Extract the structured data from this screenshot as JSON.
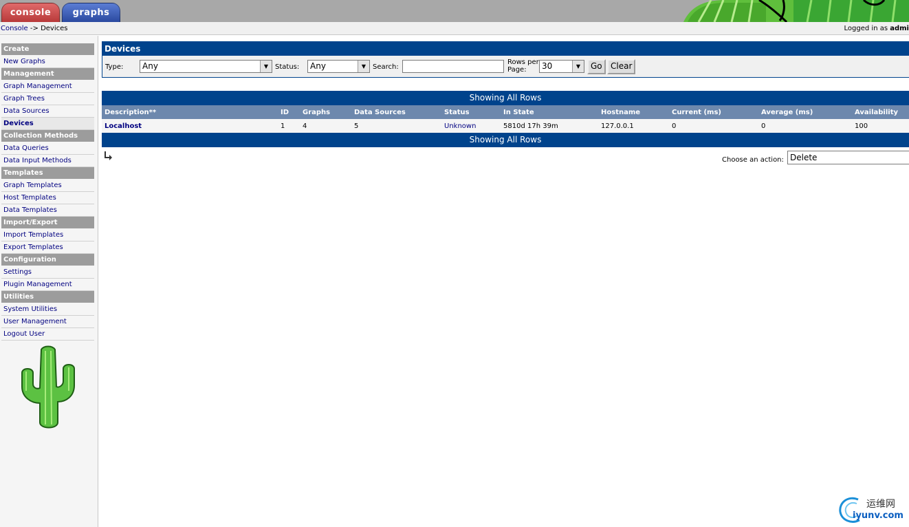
{
  "tabs": {
    "console": "console",
    "graphs": "graphs"
  },
  "breadcrumb": {
    "root": "Console",
    "separator": " -> ",
    "current": "Devices"
  },
  "login": {
    "prefix": "Logged in as ",
    "user": "admi"
  },
  "sidebar": [
    {
      "type": "header",
      "label": "Create"
    },
    {
      "type": "item",
      "label": "New Graphs"
    },
    {
      "type": "header",
      "label": "Management"
    },
    {
      "type": "item",
      "label": "Graph Management"
    },
    {
      "type": "item",
      "label": "Graph Trees"
    },
    {
      "type": "item",
      "label": "Data Sources"
    },
    {
      "type": "item",
      "label": "Devices",
      "active": true
    },
    {
      "type": "header",
      "label": "Collection Methods"
    },
    {
      "type": "item",
      "label": "Data Queries"
    },
    {
      "type": "item",
      "label": "Data Input Methods"
    },
    {
      "type": "header",
      "label": "Templates"
    },
    {
      "type": "item",
      "label": "Graph Templates"
    },
    {
      "type": "item",
      "label": "Host Templates"
    },
    {
      "type": "item",
      "label": "Data Templates"
    },
    {
      "type": "header",
      "label": "Import/Export"
    },
    {
      "type": "item",
      "label": "Import Templates"
    },
    {
      "type": "item",
      "label": "Export Templates"
    },
    {
      "type": "header",
      "label": "Configuration"
    },
    {
      "type": "item",
      "label": "Settings"
    },
    {
      "type": "item",
      "label": "Plugin Management"
    },
    {
      "type": "header",
      "label": "Utilities"
    },
    {
      "type": "item",
      "label": "System Utilities"
    },
    {
      "type": "item",
      "label": "User Management"
    },
    {
      "type": "item",
      "label": "Logout User"
    }
  ],
  "filter": {
    "title": "Devices",
    "type_label": "Type:",
    "type_value": "Any",
    "status_label": "Status:",
    "status_value": "Any",
    "search_label": "Search:",
    "search_value": "",
    "rows_label_1": "Rows per",
    "rows_label_2": "Page:",
    "rows_value": "30",
    "go_label": "Go",
    "clear_label": "Clear"
  },
  "results": {
    "showing_text": "Showing All Rows",
    "columns": [
      "Description**",
      "ID",
      "Graphs",
      "Data Sources",
      "Status",
      "In State",
      "Hostname",
      "Current (ms)",
      "Average (ms)",
      "Availability"
    ],
    "rows": [
      [
        "Localhost",
        "1",
        "4",
        "5",
        "Unknown",
        "5810d 17h 39m",
        "127.0.0.1",
        "0",
        "0",
        "100"
      ]
    ]
  },
  "action": {
    "label": "Choose an action:",
    "value": "Delete"
  },
  "watermark": {
    "line1": "运维网",
    "line2": "iyunv.com"
  },
  "colors": {
    "header_blue": "#00438c",
    "column_header": "#6d88ad",
    "menu_header": "#9c9c9c",
    "link": "#000080"
  }
}
